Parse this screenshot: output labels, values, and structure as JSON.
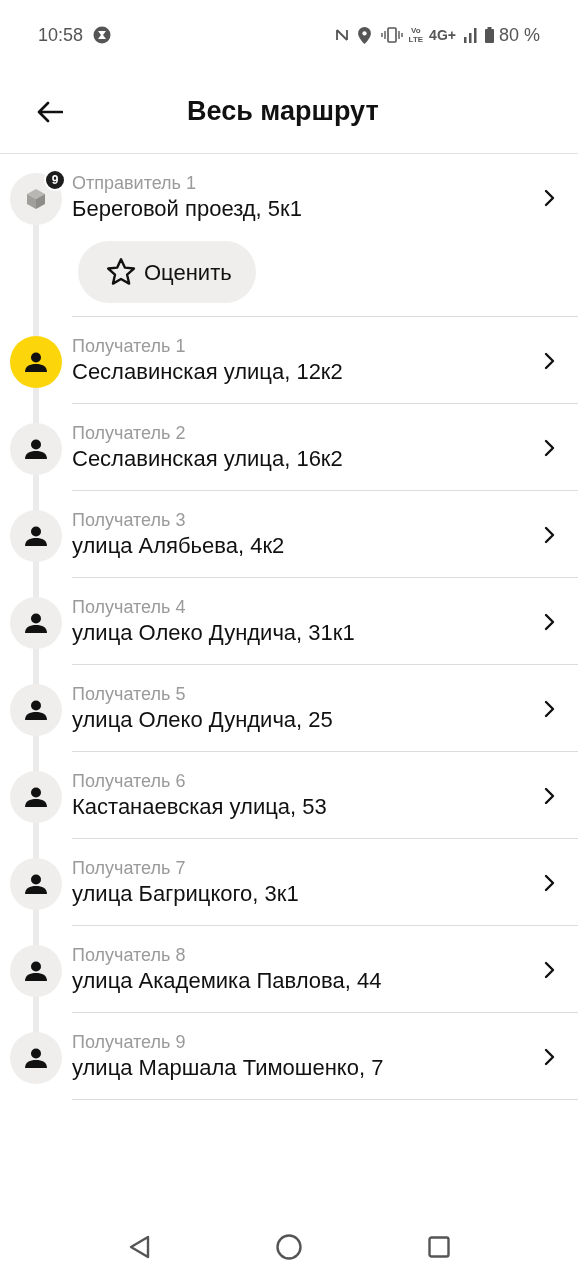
{
  "status_bar": {
    "time": "10:58",
    "volte_top": "Vo",
    "volte_bottom": "LTE",
    "network": "4G+",
    "battery": "80 %"
  },
  "header": {
    "title": "Весь маршрут"
  },
  "stops": [
    {
      "kind": "sender",
      "label": "Отправитель 1",
      "address": "Береговой проезд, 5к1",
      "badge": "9",
      "selected": false,
      "action": "Оценить"
    },
    {
      "kind": "recipient",
      "label": "Получатель 1",
      "address": "Сеславинская улица, 12к2",
      "selected": true
    },
    {
      "kind": "recipient",
      "label": "Получатель 2",
      "address": "Сеславинская улица, 16к2",
      "selected": false
    },
    {
      "kind": "recipient",
      "label": "Получатель 3",
      "address": "улица Алябьева, 4к2",
      "selected": false
    },
    {
      "kind": "recipient",
      "label": "Получатель 4",
      "address": "улица Олеко Дундича, 31к1",
      "selected": false
    },
    {
      "kind": "recipient",
      "label": "Получатель 5",
      "address": "улица Олеко Дундича, 25",
      "selected": false
    },
    {
      "kind": "recipient",
      "label": "Получатель 6",
      "address": "Кастанаевская улица, 53",
      "selected": false
    },
    {
      "kind": "recipient",
      "label": "Получатель 7",
      "address": "улица Багрицкого, 3к1",
      "selected": false
    },
    {
      "kind": "recipient",
      "label": "Получатель 8",
      "address": "улица Академика Павлова, 44",
      "selected": false
    },
    {
      "kind": "recipient",
      "label": "Получатель 9",
      "address": "улица Маршала Тимошенко, 7",
      "selected": false
    }
  ]
}
